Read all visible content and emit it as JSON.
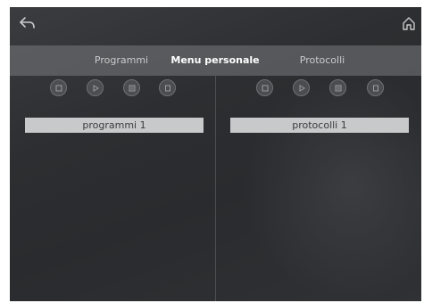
{
  "header": {
    "back_icon": "back-arrow-icon",
    "home_icon": "home-icon"
  },
  "tabs": [
    {
      "label": "Programmi",
      "active": false
    },
    {
      "label": "Menu personale",
      "active": true
    },
    {
      "label": "Protocolli",
      "active": false
    }
  ],
  "left_panel": {
    "buttons": [
      "stop-icon",
      "play-icon",
      "list-icon",
      "pause-icon"
    ],
    "items": [
      {
        "label": "programmi 1"
      }
    ]
  },
  "right_panel": {
    "buttons": [
      "stop-icon",
      "play-icon",
      "list-icon",
      "pause-icon"
    ],
    "items": [
      {
        "label": "protocolli 1"
      }
    ]
  },
  "colors": {
    "background": "#2c2e31",
    "tabbar": "#7a7c7f",
    "list_item": "#c8c9ca",
    "active_tab_text": "#ffffff"
  }
}
